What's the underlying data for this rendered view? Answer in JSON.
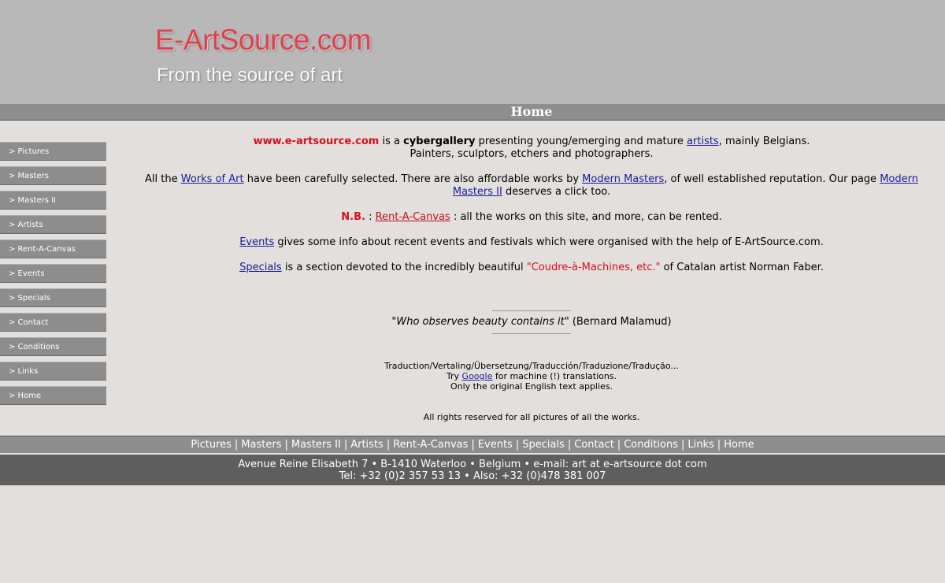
{
  "header": {
    "logo": "E-ArtSource.com",
    "tagline": "From the source of art"
  },
  "page_title": "Home",
  "sidebar": {
    "items": [
      {
        "label": "> Pictures"
      },
      {
        "label": "> Masters"
      },
      {
        "label": "> Masters II"
      },
      {
        "label": "> Artists"
      },
      {
        "label": "> Rent-A-Canvas"
      },
      {
        "label": "> Events"
      },
      {
        "label": "> Specials"
      },
      {
        "label": "> Contact"
      },
      {
        "label": "> Conditions"
      },
      {
        "label": "> Links"
      },
      {
        "label": "> Home"
      }
    ]
  },
  "intro": {
    "site": "www.e-artsource.com",
    "is_a": " is a ",
    "cybergallery": "cybergallery",
    "presenting": " presenting young/emerging and mature ",
    "artists_link": "artists",
    "mainly": ", mainly Belgians.",
    "line2": "Painters, sculptors, etchers and photographers."
  },
  "works": {
    "all_the": "All the ",
    "works_link": "Works of Art",
    "selected": " have been carefully selected. There are also affordable works by ",
    "modern_masters_link": "Modern Masters",
    "reputation": ", of well established reputation. Our page ",
    "modern_masters2_link": "Modern Masters II",
    "deserves": " deserves a click too."
  },
  "nb": {
    "label": "N.B.",
    "colon": " : ",
    "rent_link": "Rent-A-Canvas",
    "text": " : all the works on this site, and more, can be rented."
  },
  "events": {
    "link": "Events",
    "text": " gives some info about recent events and festivals which were organised with the help of E-ArtSource.com."
  },
  "specials": {
    "link": "Specials",
    "text": " is a section devoted to the incredibly beautiful ",
    "highlight": "\"Coudre-à-Machines, etc.\"",
    "text2": " of Catalan artist Norman Faber."
  },
  "quote": {
    "text": "\"Who observes beauty contains it\"",
    "author": " (Bernard Malamud)"
  },
  "translation": {
    "line1": "Traduction/Vertaling/Übersetzung/Traducción/Traduzione/Tradução...",
    "try": "Try ",
    "google_link": "Google",
    "for_machine": " for machine (!) translations.",
    "line3": "Only the original English text applies."
  },
  "rights": "All rights reserved for all pictures of all the works.",
  "footer_nav": [
    "Pictures",
    "Masters",
    "Masters II",
    "Artists",
    "Rent-A-Canvas",
    "Events",
    "Specials",
    "Contact",
    "Conditions",
    "Links",
    "Home"
  ],
  "footer_sep": "|",
  "footer": {
    "address": "Avenue Reine Elisabeth 7 • B-1410 Waterloo • Belgium • e-mail: art at e-artsource dot com",
    "phone": "Tel: +32 (0)2 357 53 13 • Also: +32 (0)478 381 007"
  },
  "colors": {
    "background": "#e3dfdc",
    "header": "#b8b8b8",
    "logo_red": "#d9434f",
    "accent_red": "#d4101e",
    "link_blue": "#1a1a9c",
    "nav_gray": "#8d8d8d",
    "footer_dark": "#5e5e5e"
  }
}
